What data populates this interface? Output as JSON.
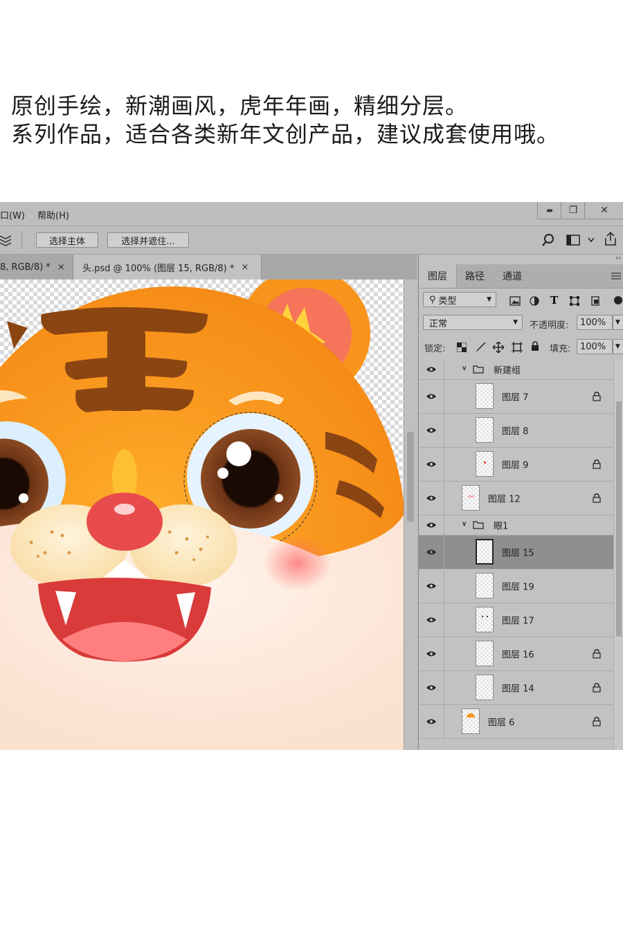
{
  "promo": {
    "line1": "原创手绘，新潮画风，虎年年画，精细分层。",
    "line2": "系列作品，适合各类新年文创产品，建议成套使用哦。"
  },
  "menubar": {
    "window_menu": "口(W)",
    "help_menu": "帮助(H)",
    "minimize": "▬",
    "restore": "❐",
    "close": "✕"
  },
  "options": {
    "select_subject": "选择主体",
    "select_and_mask": "选择并遮住..."
  },
  "tabs": [
    {
      "label": "8, RGB/8) *",
      "close": "×"
    },
    {
      "label": "头.psd @ 100% (图层 15, RGB/8) *",
      "close": "×"
    }
  ],
  "panel": {
    "tabs": [
      "图层",
      "路径",
      "通道"
    ],
    "filter_kind": "类型",
    "blend_mode": "正常",
    "opacity_label": "不透明度:",
    "opacity_value": "100%",
    "lock_label": "锁定:",
    "fill_label": "填充:",
    "fill_value": "100%",
    "layers": [
      {
        "name": "新建组",
        "type": "group"
      },
      {
        "name": "图层 7",
        "type": "layer",
        "locked": true
      },
      {
        "name": "图层 8",
        "type": "layer",
        "locked": false
      },
      {
        "name": "图层 9",
        "type": "layer",
        "locked": true
      },
      {
        "name": "图层 12",
        "type": "layer",
        "locked": true
      },
      {
        "name": "眼1",
        "type": "group"
      },
      {
        "name": "图层 15",
        "type": "layer",
        "locked": false,
        "selected": true
      },
      {
        "name": "图层 19",
        "type": "layer",
        "locked": false
      },
      {
        "name": "图层 17",
        "type": "layer",
        "locked": false
      },
      {
        "name": "图层 16",
        "type": "layer",
        "locked": true
      },
      {
        "name": "图层 14",
        "type": "layer",
        "locked": true
      },
      {
        "name": "图层 6",
        "type": "layer",
        "locked": true
      }
    ]
  },
  "colors": {
    "tiger_orange": "#f7931e",
    "stripe_brown": "#8b4513",
    "nose_red": "#e84b4b",
    "muzzle_cream": "#fde7c1",
    "mouth_red": "#d93a3a"
  },
  "icons": [
    "search-icon",
    "workspace-icon",
    "share-icon",
    "panel-menu-icon",
    "eye-icon",
    "lock-icon",
    "folder-icon"
  ]
}
